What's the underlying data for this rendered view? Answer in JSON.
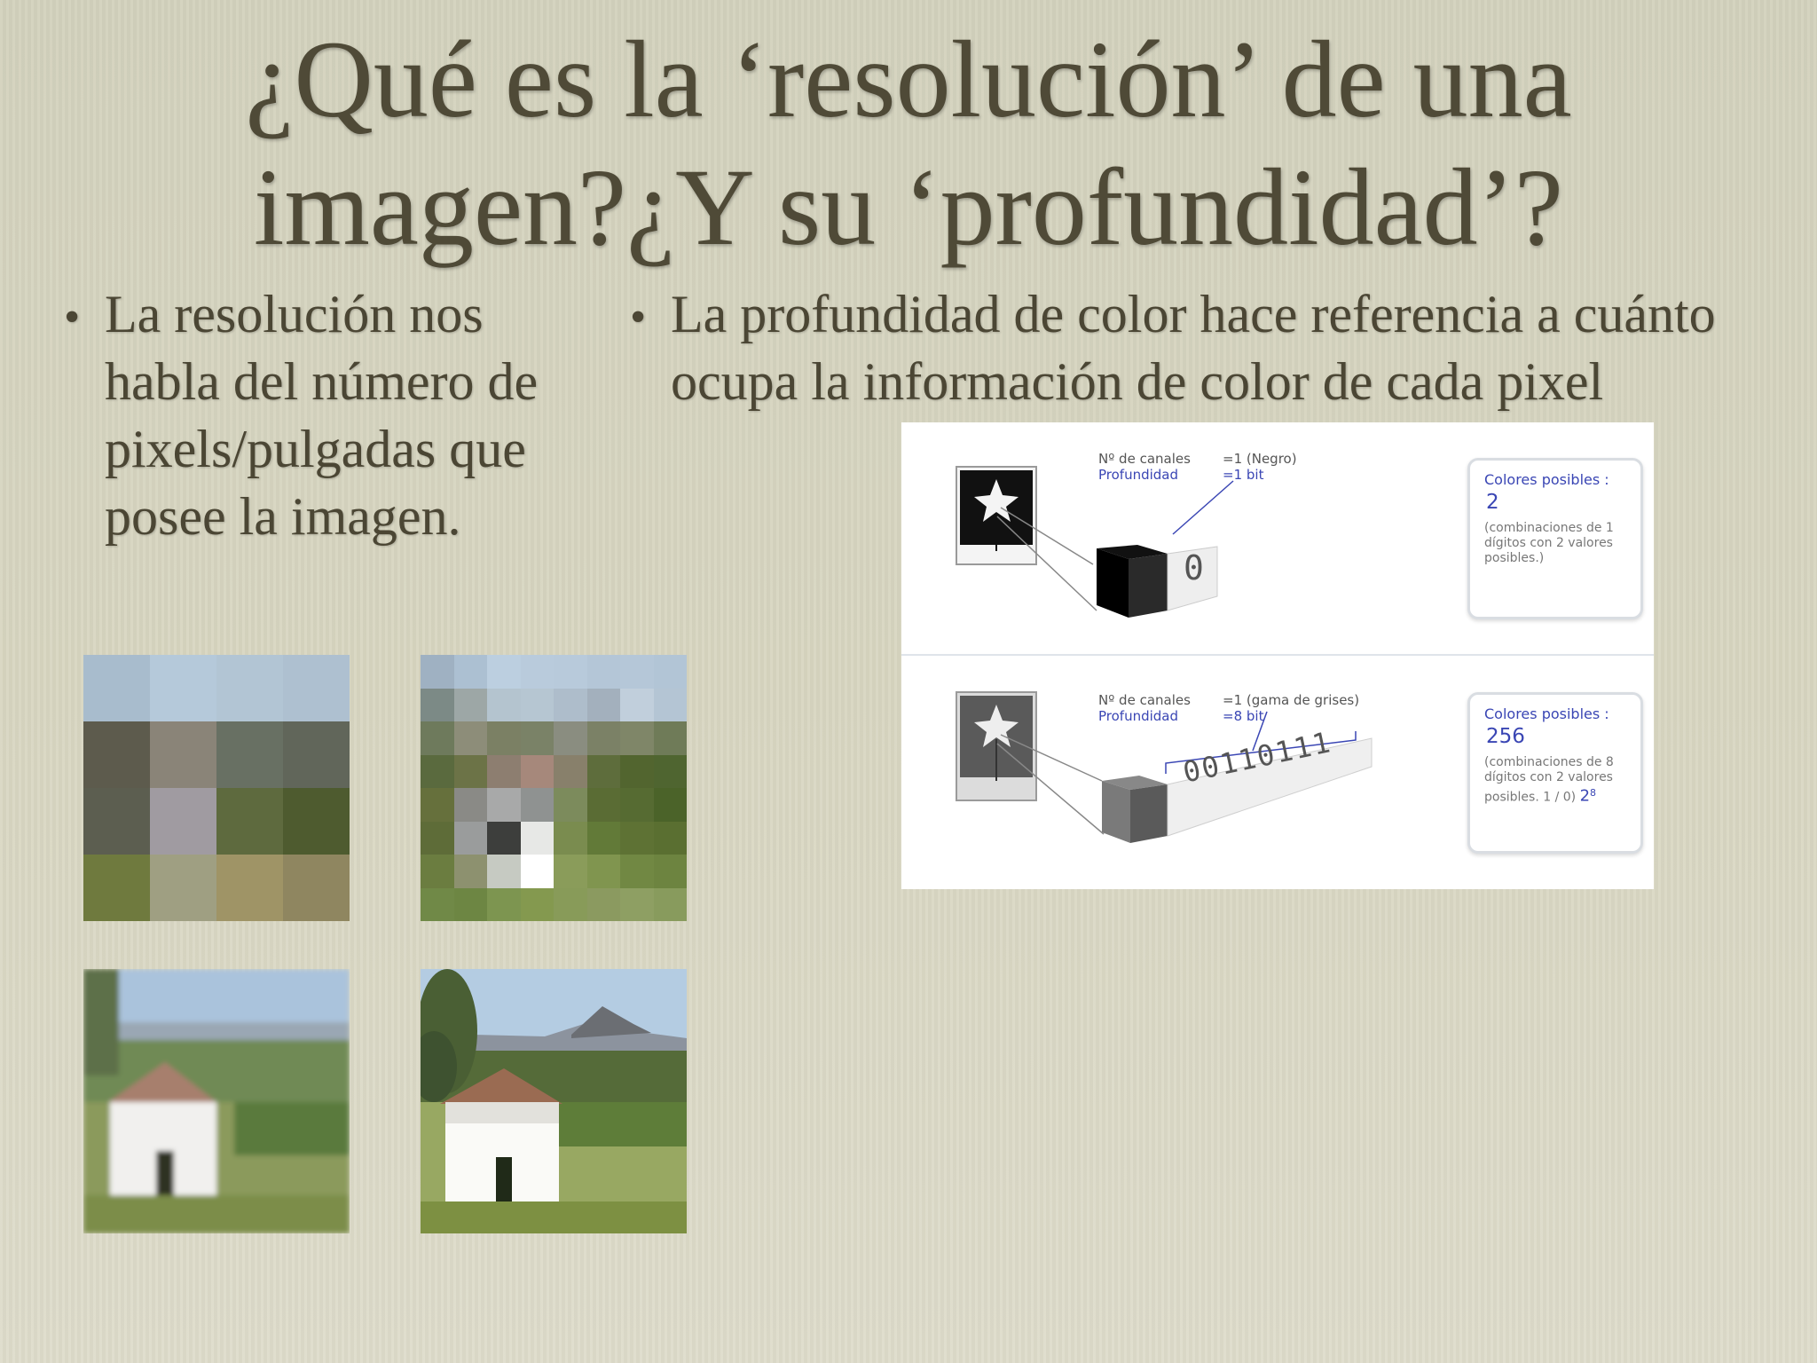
{
  "slide": {
    "title_line1": "¿Qué es la ‘resolución’ de una",
    "title_line2": "imagen?¿Y su ‘profundidad’?",
    "left_bullet": "La resolución nos habla del número de pixels/pulgadas que posee la imagen.",
    "right_bullet": "La profundidad de color hace referencia a cuánto ocupa la información de color de cada pixel"
  },
  "pixel_grid_4": [
    "#a8bccd",
    "#b5c9da",
    "#b2c5d4",
    "#aec0d0",
    "#5d5b4d",
    "#8a8478",
    "#687063",
    "#61665a",
    "#5c5e50",
    "#a09ba1",
    "#5e6a3e",
    "#4e5b2f",
    "#6f7a3e",
    "#9f9f82",
    "#9f9466",
    "#8f8660"
  ],
  "pixel_grid_8": [
    "#9fb1c2",
    "#acc0d2",
    "#bccfe0",
    "#b9cbdc",
    "#b8cadb",
    "#b4c6d7",
    "#b5c7d8",
    "#b2c5d6",
    "#7c8a86",
    "#9da7a6",
    "#b4c4cf",
    "#b6c6d2",
    "#aebdcb",
    "#a3b0bd",
    "#c1cfdc",
    "#b4c5d4",
    "#6e7a5c",
    "#8d8d79",
    "#7b8064",
    "#7a8267",
    "#8a8d80",
    "#7b8166",
    "#7f8668",
    "#6f7b58",
    "#5a6a3e",
    "#6c7347",
    "#8d7e70",
    "#a6887b",
    "#88806b",
    "#5e6d3c",
    "#52652f",
    "#4f6530",
    "#66703c",
    "#8a8a86",
    "#a8a9a9",
    "#8f9291",
    "#7c8b5c",
    "#5a6c34",
    "#566b32",
    "#4b6329",
    "#5e6c38",
    "#9a9c9c",
    "#3d3e3c",
    "#e7e8e6",
    "#7a8c4f",
    "#627a38",
    "#5e7234",
    "#5a6f31",
    "#6b7d40",
    "#8d916f",
    "#c6cac2",
    "#ffffff",
    "#8a9c5a",
    "#80954f",
    "#718843",
    "#6d8440",
    "#708947",
    "#6d8643",
    "#7d9550",
    "#84994f",
    "#889b59",
    "#8b9a60",
    "#8e9f63",
    "#889b5d"
  ],
  "photos": {
    "blurry_alt": "dovecote-low-res",
    "sharp_alt": "dovecote-high-res"
  },
  "depth_diagram": {
    "panel1": {
      "label_channels": "Nº de canales",
      "label_depth": "Profundidad",
      "value_channels": "=1 (Negro)",
      "value_depth": "=1 bit",
      "bits": "0",
      "colors_title": "Colores posibles :",
      "colors_number": "2",
      "colors_desc": "(combinaciones de 1 dígitos con 2 valores posibles.)"
    },
    "panel2": {
      "label_channels": "Nº de canales",
      "label_depth": "Profundidad",
      "value_channels": "=1 (gama de grises)",
      "value_depth": "=8 bit",
      "bits": "00110111",
      "colors_title": "Colores posibles :",
      "colors_number": "256",
      "colors_desc": "(combinaciones de 8 dígitos con 2 valores posibles. 1 / 0)",
      "power_base": "2",
      "power_exp": "8"
    }
  }
}
